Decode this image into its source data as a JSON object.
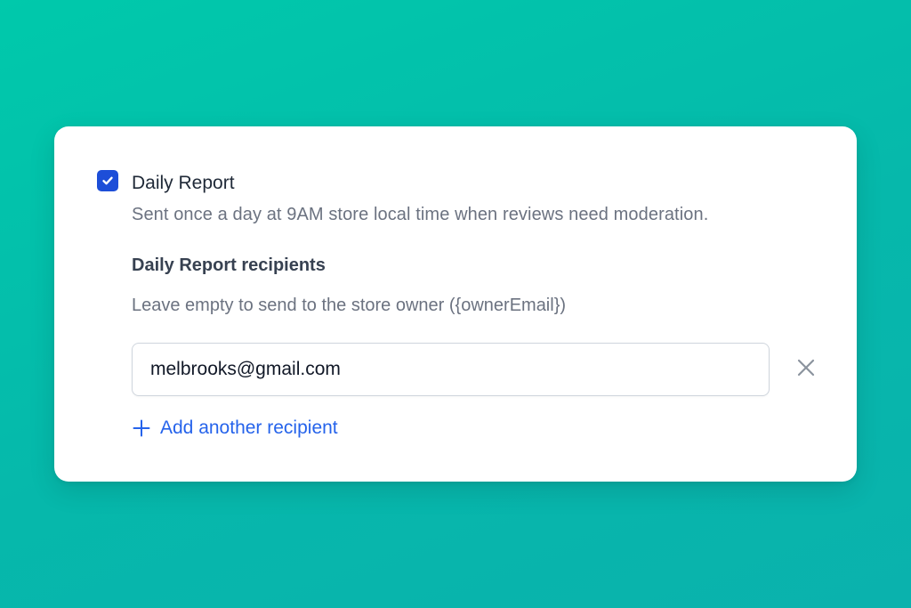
{
  "option": {
    "checked": true,
    "title": "Daily Report",
    "description": "Sent once a day at 9AM store local time when reviews need moderation."
  },
  "recipients": {
    "label": "Daily Report recipients",
    "help": "Leave empty to send to the store owner ({ownerEmail})",
    "items": [
      {
        "email": "melbrooks@gmail.com"
      }
    ],
    "add_label": "Add another recipient"
  },
  "colors": {
    "accent": "#1d4ed8",
    "link": "#2563eb",
    "muted_text": "#6b7280"
  },
  "icons": {
    "checkbox": "check-icon",
    "remove": "close-icon",
    "add": "plus-icon"
  }
}
